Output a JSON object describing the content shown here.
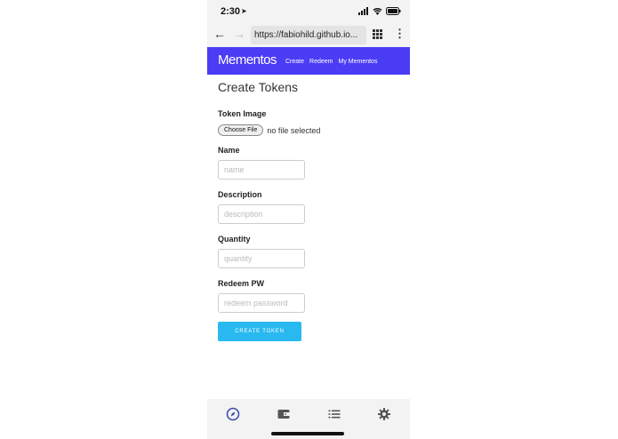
{
  "status_bar": {
    "time": "2:30",
    "location_icon": "location-arrow-icon",
    "signal_icon": "signal-icon",
    "wifi_icon": "wifi-icon",
    "battery_icon": "battery-icon"
  },
  "browser": {
    "back_icon": "back-arrow-icon",
    "forward_icon": "forward-arrow-icon",
    "url": "https://fabiohild.github.io...",
    "apps_icon": "grid-icon",
    "menu_icon": "more-vertical-icon"
  },
  "navbar": {
    "brand": "Mementos",
    "links": [
      "Create",
      "Redeem",
      "My Mementos"
    ],
    "background": "#4b3cf5"
  },
  "page": {
    "title": "Create Tokens",
    "token_image_label": "Token Image",
    "choose_file_label": "Choose File",
    "no_file_text": "no file selected",
    "name_label": "Name",
    "name_placeholder": "name",
    "description_label": "Description",
    "description_placeholder": "description",
    "quantity_label": "Quantity",
    "quantity_placeholder": "quantity",
    "redeem_label": "Redeem PW",
    "redeem_placeholder": "redeem password",
    "create_button": "CREATE TOKEN",
    "create_button_color": "#29b9f0"
  },
  "tabbar": {
    "tabs": [
      "compass-icon",
      "wallet-icon",
      "list-icon",
      "gear-icon"
    ],
    "active_color": "#3b4fb0"
  }
}
